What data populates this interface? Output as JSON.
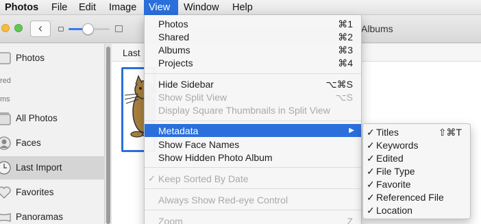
{
  "menubar": {
    "items": [
      "Photos",
      "File",
      "Edit",
      "Image",
      "View",
      "Window",
      "Help"
    ]
  },
  "toolbar": {
    "back_label": "‹",
    "window_title_fragment": "Albums"
  },
  "sidebar": {
    "sections": [
      "red",
      "ms"
    ],
    "items": [
      "Photos",
      "All Photos",
      "Faces",
      "Last Import",
      "Favorites",
      "Panoramas"
    ],
    "selected": "Last Import"
  },
  "main": {
    "header_label": "Last"
  },
  "view_menu": {
    "items": [
      {
        "label": "Photos",
        "shortcut": "⌘1"
      },
      {
        "label": "Shared",
        "shortcut": "⌘2"
      },
      {
        "label": "Albums",
        "shortcut": "⌘3"
      },
      {
        "label": "Projects",
        "shortcut": "⌘4"
      },
      {
        "label": "Hide Sidebar",
        "shortcut": "⌥⌘S"
      },
      {
        "label": "Show Split View",
        "shortcut": "⌥S"
      },
      {
        "label": "Display Square Thumbnails in Split View",
        "shortcut": ""
      },
      {
        "label": "Metadata",
        "shortcut": "▶"
      },
      {
        "label": "Show Face Names",
        "shortcut": ""
      },
      {
        "label": "Show Hidden Photo Album",
        "shortcut": ""
      },
      {
        "label": "Keep Sorted By Date",
        "check": "✓"
      },
      {
        "label": "Always Show Red-eye Control",
        "shortcut": ""
      },
      {
        "label": "Zoom",
        "shortcut": "Z"
      }
    ]
  },
  "metadata_submenu": {
    "items": [
      {
        "label": "Titles",
        "check": "✓",
        "shortcut": "⇧⌘T"
      },
      {
        "label": "Keywords",
        "check": "✓"
      },
      {
        "label": "Edited",
        "check": "✓"
      },
      {
        "label": "File Type",
        "check": "✓"
      },
      {
        "label": "Favorite",
        "check": "✓"
      },
      {
        "label": "Referenced File",
        "check": "✓"
      },
      {
        "label": "Location",
        "check": "✓"
      }
    ]
  },
  "colors": {
    "highlight": "#2a6fdb",
    "traffic_yellow": "#f5bd3a",
    "traffic_green": "#62c654"
  }
}
